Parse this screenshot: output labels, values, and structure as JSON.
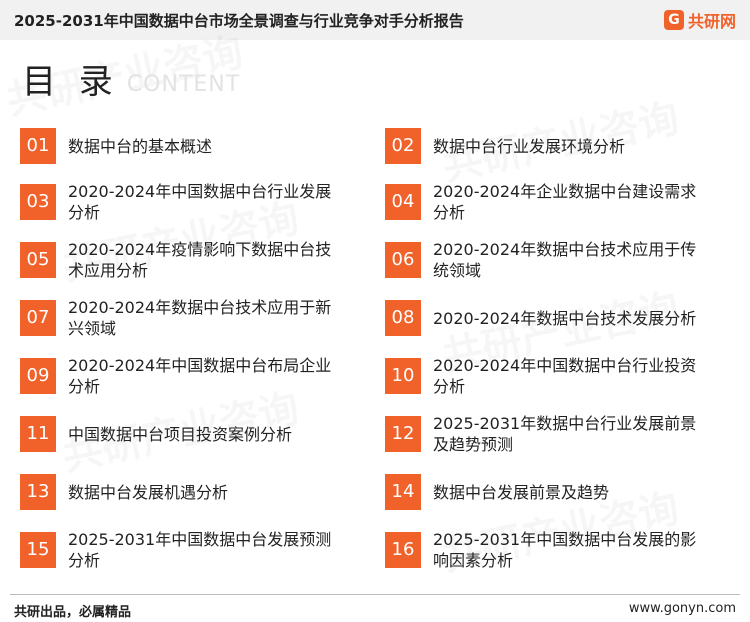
{
  "header": {
    "title": "2025-2031年中国数据中台市场全景调查与行业竞争对手分析报告",
    "brand_name": "共研网",
    "brand_icon_glyph": "G"
  },
  "heading": {
    "cn": "目 录",
    "en": "CONTENT"
  },
  "watermark_text": "共研产业咨询",
  "toc": [
    {
      "num": "01",
      "text": "数据中台的基本概述"
    },
    {
      "num": "02",
      "text": "数据中台行业发展环境分析"
    },
    {
      "num": "03",
      "text": "2020-2024年中国数据中台行业发展分析"
    },
    {
      "num": "04",
      "text": "2020-2024年企业数据中台建设需求分析"
    },
    {
      "num": "05",
      "text": "2020-2024年疫情影响下数据中台技术应用分析"
    },
    {
      "num": "06",
      "text": "2020-2024年数据中台技术应用于传统领域"
    },
    {
      "num": "07",
      "text": "2020-2024年数据中台技术应用于新兴领域"
    },
    {
      "num": "08",
      "text": "2020-2024年数据中台技术发展分析"
    },
    {
      "num": "09",
      "text": "2020-2024年中国数据中台布局企业分析"
    },
    {
      "num": "10",
      "text": "2020-2024年中国数据中台行业投资分析"
    },
    {
      "num": "11",
      "text": "中国数据中台项目投资案例分析"
    },
    {
      "num": "12",
      "text": "2025-2031年数据中台行业发展前景及趋势预测"
    },
    {
      "num": "13",
      "text": "数据中台发展机遇分析"
    },
    {
      "num": "14",
      "text": "数据中台发展前景及趋势"
    },
    {
      "num": "15",
      "text": "2025-2031年中国数据中台发展预测分析"
    },
    {
      "num": "16",
      "text": "2025-2031年中国数据中台发展的影响因素分析"
    }
  ],
  "footer": {
    "left": "共研出品，必属精品",
    "right": "www.gonyn.com"
  },
  "colors": {
    "accent": "#f0622a",
    "topbar": "#f1f1f1"
  }
}
